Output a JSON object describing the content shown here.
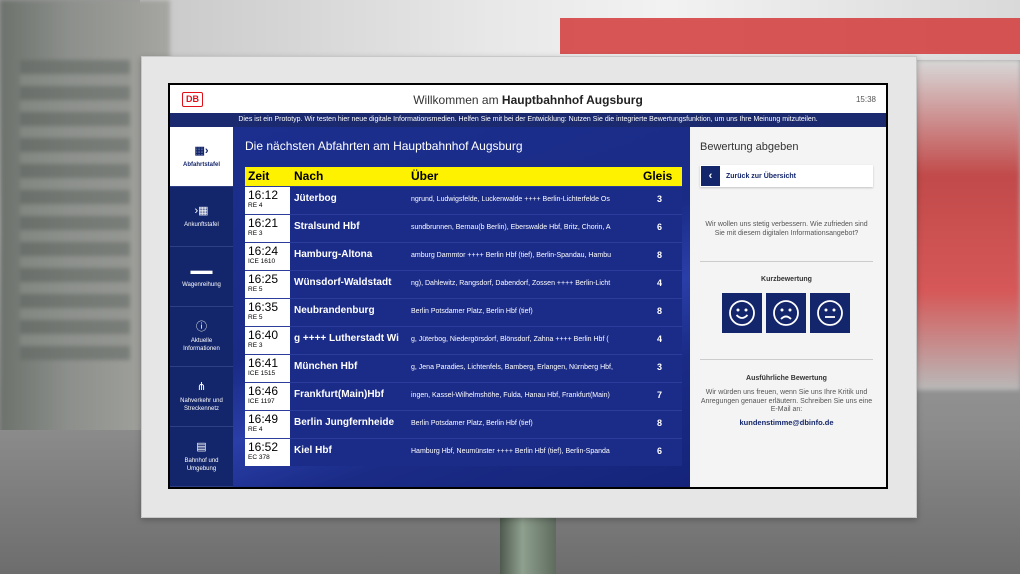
{
  "header": {
    "logo": "DB",
    "welcome_prefix": "Willkommen am",
    "welcome_station": "Hauptbahnhof Augsburg",
    "time": "15:38"
  },
  "banner": "Dies ist ein Prototyp. Wir testen hier neue digitale Informationsmedien. Helfen Sie mit bei der Entwicklung: Nutzen Sie die integrierte Bewertungsfunktion, um uns Ihre Meinung mitzuteilen.",
  "sidebar": {
    "items": [
      {
        "label": "Abfahrtstafel",
        "icon": "departures-icon",
        "active": true
      },
      {
        "label": "Ankunftstafel",
        "icon": "arrivals-icon",
        "active": false
      },
      {
        "label": "Wagenreihung",
        "icon": "train-formation-icon",
        "active": false
      },
      {
        "label": "Aktuelle Informationen",
        "icon": "info-icon",
        "active": false
      },
      {
        "label": "Nahverkehr und Streckennetz",
        "icon": "network-icon",
        "active": false
      },
      {
        "label": "Bahnhof und Umgebung",
        "icon": "station-icon",
        "active": false
      }
    ]
  },
  "board": {
    "title": "Die nächsten Abfahrten am Hauptbahnhof Augsburg",
    "columns": {
      "time": "Zeit",
      "destination": "Nach",
      "via": "Über",
      "track": "Gleis"
    },
    "rows": [
      {
        "time": "16:12",
        "train": "RE 4",
        "destination": "Jüterbog",
        "via": "ngrund, Ludwigsfelde, Luckenwalde ++++ Berlin-Lichterfelde Os",
        "track": "3"
      },
      {
        "time": "16:21",
        "train": "RE 3",
        "destination": "Stralsund Hbf",
        "via": "sundbrunnen, Bernau(b Berlin), Eberswalde Hbf, Britz, Chorin, A",
        "track": "6"
      },
      {
        "time": "16:24",
        "train": "ICE 1610",
        "destination": "Hamburg-Altona",
        "via": "amburg Dammtor ++++ Berlin Hbf (tief), Berlin-Spandau, Hambu",
        "track": "8"
      },
      {
        "time": "16:25",
        "train": "RE 5",
        "destination": "Wünsdorf-Waldstadt",
        "via": "ng), Dahlewitz, Rangsdorf, Dabendorf, Zossen ++++ Berlin-Licht",
        "track": "4"
      },
      {
        "time": "16:35",
        "train": "RE 5",
        "destination": "Neubrandenburg",
        "via": "Berlin Potsdamer Platz, Berlin Hbf (tief)",
        "track": "8"
      },
      {
        "time": "16:40",
        "train": "RE 3",
        "destination": "g ++++ Lutherstadt Wi",
        "via": "g, Jüterbog, Niedergörsdorf, Blönsdorf, Zahna ++++ Berlin Hbf (",
        "track": "4"
      },
      {
        "time": "16:41",
        "train": "ICE 1515",
        "destination": "München Hbf",
        "via": "g, Jena Paradies, Lichtenfels, Bamberg, Erlangen, Nürnberg Hbf,",
        "track": "3"
      },
      {
        "time": "16:46",
        "train": "ICE 1197",
        "destination": "Frankfurt(Main)Hbf",
        "via": "ingen, Kassel-Wilhelmshöhe, Fulda, Hanau Hbf, Frankfurt(Main)",
        "track": "7"
      },
      {
        "time": "16:49",
        "train": "RE 4",
        "destination": "Berlin Jungfernheide",
        "via": "Berlin Potsdamer Platz, Berlin Hbf (tief)",
        "track": "8"
      },
      {
        "time": "16:52",
        "train": "EC 378",
        "destination": "Kiel Hbf",
        "via": "Hamburg Hbf, Neumünster ++++ Berlin Hbf (tief), Berlin-Spanda",
        "track": "6"
      }
    ]
  },
  "rating": {
    "title": "Bewertung abgeben",
    "back_label": "Zurück zur Übersicht",
    "intro": "Wir wollen uns stetig verbessern. Wie zufrieden sind Sie mit diesem digitalen Informationsangebot?",
    "quick_title": "Kurzbewertung",
    "faces": [
      "smile-icon",
      "frown-icon",
      "neutral-icon"
    ],
    "detail_title": "Ausführliche Bewertung",
    "detail_text": "Wir würden uns freuen, wenn Sie uns Ihre Kritik und Anregungen genauer erläutern. Schreiben Sie uns eine E-Mail an:",
    "email": "kundenstimme@dbinfo.de"
  },
  "colors": {
    "primary": "#14266b",
    "board_bg": "#1b2b88",
    "header_yellow": "#fff200",
    "db_red": "#e0101a"
  }
}
